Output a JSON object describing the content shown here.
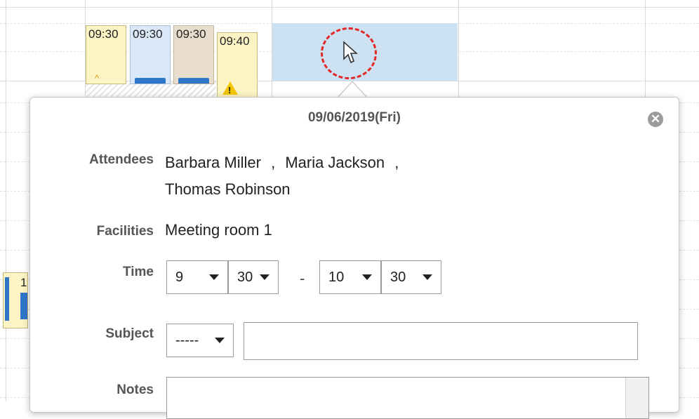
{
  "calendar": {
    "events": [
      {
        "time": "09:30",
        "color": "yellow",
        "marker": "caret"
      },
      {
        "time": "09:30",
        "color": "blue",
        "marker": "bar"
      },
      {
        "time": "09:30",
        "color": "tan",
        "marker": "bar"
      },
      {
        "time": "09:40",
        "color": "yellow",
        "marker": "warning"
      }
    ],
    "side_event_text": "1"
  },
  "popup": {
    "date": "09/06/2019(Fri)",
    "attendees_label": "Attendees",
    "attendees": [
      "Barbara Miller",
      "Maria Jackson",
      "Thomas Robinson"
    ],
    "attendee_separator": ",",
    "facilities_label": "Facilities",
    "facilities": "Meeting room 1",
    "time_label": "Time",
    "start_hour": "9",
    "start_minute": "30",
    "time_separator": "-",
    "end_hour": "10",
    "end_minute": "30",
    "subject_label": "Subject",
    "subject_menu": "-----",
    "subject_value": "",
    "notes_label": "Notes",
    "notes_value": ""
  },
  "icons": {
    "close": "close-circle-icon",
    "cursor": "mouse-pointer-icon",
    "warning": "warning-triangle-icon",
    "dropdown": "chevron-down-icon"
  },
  "colors": {
    "selected_slot": "#cce1f2",
    "cursor_ring": "#e32626",
    "event_yellow": "#fcf4c4",
    "event_blue": "#dbe8f8",
    "event_tan": "#e8dccd",
    "accent_blue": "#2f76c8"
  }
}
